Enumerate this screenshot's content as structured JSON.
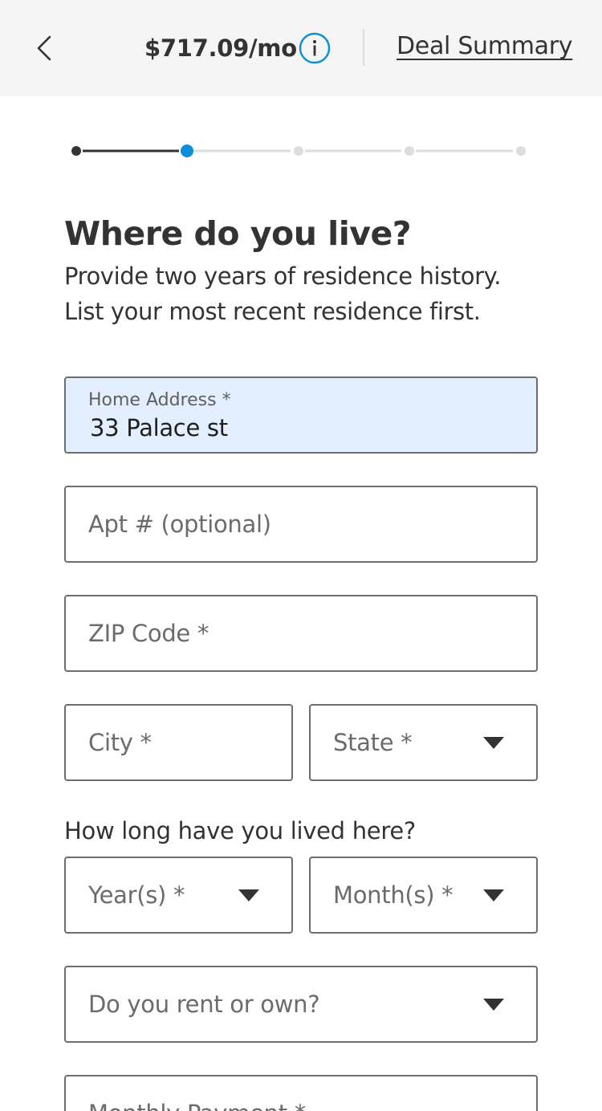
{
  "header": {
    "back_icon": "chevron-left-icon",
    "price": "$717.09/mo",
    "info_icon": "info-circle-icon",
    "deal_summary": "Deal Summary"
  },
  "stepper": {
    "total_steps": 5,
    "current_step": 2,
    "active_color": "#0a8fd6",
    "done_color": "#333333",
    "pending_color": "#dddddd"
  },
  "main": {
    "title": "Where do you live?",
    "subtitle_line1": "Provide two years of residence history.",
    "subtitle_line2": "List your most recent residence first."
  },
  "form": {
    "home_address": {
      "label": "Home Address *",
      "value": "33 Palace st"
    },
    "apt": {
      "placeholder": "Apt # (optional)"
    },
    "zip": {
      "placeholder": "ZIP Code *"
    },
    "city": {
      "placeholder": "City *"
    },
    "state": {
      "placeholder": "State *"
    },
    "duration_question": "How long have you lived here?",
    "years": {
      "placeholder": "Year(s) *"
    },
    "months": {
      "placeholder": "Month(s) *"
    },
    "rent_own": {
      "placeholder": "Do you rent or own?"
    },
    "monthly_payment": {
      "placeholder": "Monthly Payment *"
    }
  },
  "colors": {
    "header_bg": "#f5f5f5",
    "active_field_bg": "#e3eefe",
    "info_icon": "#0a8fd6",
    "text": "#333333",
    "border": "#6d6d6d"
  }
}
